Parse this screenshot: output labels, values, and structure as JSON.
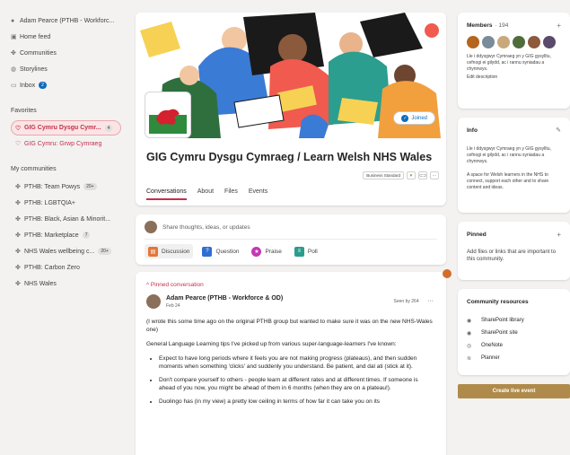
{
  "sidebar": {
    "top": [
      {
        "label": "Adam Pearce (PTHB - Workforc...",
        "icon": "user-icon"
      },
      {
        "label": "Home feed",
        "icon": "home-icon"
      },
      {
        "label": "Communities",
        "icon": "communities-icon"
      },
      {
        "label": "Storylines",
        "icon": "storylines-icon"
      },
      {
        "label": "Inbox",
        "icon": "inbox-icon",
        "badge": "2"
      }
    ],
    "favorites_heading": "Favorites",
    "favorites": [
      {
        "label": "GIG Cymru Dysgu Cymr...",
        "count": "4",
        "active": true
      },
      {
        "label": "GIG Cymru: Grwp Cymraeg",
        "active": false
      }
    ],
    "communities_heading": "My communities",
    "communities": [
      {
        "label": "PTHB: Team Powys",
        "count": "20+"
      },
      {
        "label": "PTHB: LGBTQIA+"
      },
      {
        "label": "PTHB: Black, Asian & Minorit..."
      },
      {
        "label": "PTHB: Marketplace",
        "count": "7"
      },
      {
        "label": "NHS Wales wellbeing c...",
        "count": "20+"
      },
      {
        "label": "PTHB: Carbon Zero"
      },
      {
        "label": "NHS Wales"
      }
    ]
  },
  "community": {
    "title": "GIG Cymru Dysgu Cymraeg / Learn Welsh NHS Wales",
    "joined_label": "Joined",
    "standard_label": "Business Standard",
    "tabs": [
      "Conversations",
      "About",
      "Files",
      "Events"
    ]
  },
  "composer": {
    "placeholder": "Share thoughts, ideas, or updates",
    "actions": [
      "Discussion",
      "Question",
      "Praise",
      "Poll"
    ]
  },
  "post": {
    "pinned_label": "Pinned conversation",
    "author": "Adam Pearce (PTHB - Workforce & OD)",
    "date": "Feb 24",
    "seen": "Seen by 264",
    "more": "···",
    "intro": "(I wrote this some time ago on the original PTHB group but wanted to make sure it was on the new NHS-Wales one)",
    "lead": "General Language Learning tips I've picked up from various super-language-learners I've known:",
    "bullets": [
      "Expect to have long periods where it feels you are not making progress (plateaus), and then sudden moments when something 'clicks' and suddenly you understand. Be patient, and dal ati (stick at it).",
      "Don't compare yourself to others - people learn at different rates and at different times. If someone is ahead of you now, you might be ahead of them in 6 months (when they are on a plateau!).",
      "Duolingo has (in my view) a pretty low ceiling in terms of how far it can take you on its"
    ]
  },
  "members": {
    "heading": "Members",
    "count": "· 194",
    "desc": "Lle i ddysgwyr Cymraeg yn y GIG gysylltu, cefnogi ei gilydd, ac i rannu syniadau a chynnwys.",
    "edit": "Edit description",
    "avatar_colors": [
      "#b5651d",
      "#7a8b99",
      "#c9a87c",
      "#4f6d3a",
      "#8e5a3c",
      "#5b4a6b"
    ]
  },
  "info": {
    "heading": "Info",
    "welsh": "Lle i ddysgwyr Cymraeg yn y GIG gysylltu, cefnogi ei gilydd, ac i rannu syniadau a chynnwys.",
    "english": "A space for Welsh learners in the NHS to connect, support each other and to share content and ideas."
  },
  "pinned": {
    "heading": "Pinned",
    "text": "Add files or links that are important to this community."
  },
  "resources": {
    "heading": "Community resources",
    "items": [
      {
        "label": "SharePoint library",
        "icon": "sharepoint-icon"
      },
      {
        "label": "SharePoint site",
        "icon": "sharepoint-icon"
      },
      {
        "label": "OneNote",
        "icon": "onenote-icon"
      },
      {
        "label": "Planner",
        "icon": "planner-icon"
      }
    ]
  },
  "live_event_label": "Create live event",
  "colors": {
    "accent": "#c4314b",
    "brand_blue": "#0f6cbd",
    "gold": "#b08a4a"
  }
}
